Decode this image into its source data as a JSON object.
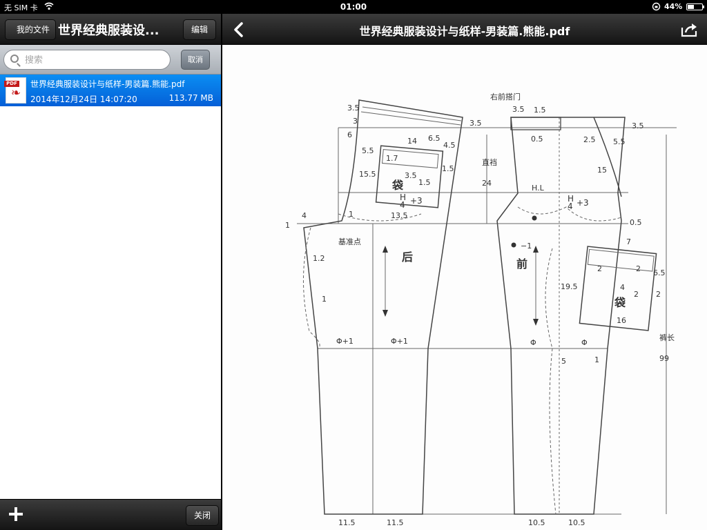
{
  "status_bar": {
    "carrier": "无 SIM 卡",
    "time": "01:00",
    "battery": "44%",
    "battery_level": 0.44
  },
  "left_pane": {
    "back_label": "我的文件",
    "title": "世界经典服装设...",
    "edit_label": "编辑",
    "search_placeholder": "搜索",
    "cancel_label": "取消",
    "file": {
      "icon_text": "PDF",
      "name": "世界经典服装设计与纸样-男装篇.熊能.pdf",
      "date": "2014年12月24日 14:07:20",
      "size": "113.77 MB"
    },
    "close_label": "关闭"
  },
  "viewer": {
    "title": "世界经典服装设计与纸样-男装篇.熊能.pdf"
  },
  "pattern": {
    "fly_label": "右前搭门",
    "fly_width": "1.5",
    "crotch_label": "直裆",
    "crotch_value": "24",
    "hip_line": "H.L",
    "reference_point": "基准点",
    "back_label": "后",
    "front_label": "前",
    "pocket_label": "袋",
    "trouser_length_label": "裤长",
    "trouser_length_value": "99",
    "hem_back": "11.5",
    "hem_front": "10.5",
    "phi_plus": "Φ+1",
    "phi": "Φ",
    "h4_num": "H",
    "h4_den": "4",
    "plus3": "+3",
    "n_35": "3.5",
    "n_3": "3",
    "n_6": "6",
    "n_14": "14",
    "n_65": "6.5",
    "n_45": "4.5",
    "n_55": "5.5",
    "n_17": "1.7",
    "n_15": "1.5",
    "n_155": "15.5",
    "n_135": "13.5",
    "n_4": "4",
    "n_1": "1",
    "n_12": "1.2",
    "n_05": "0.5",
    "n_25": "2.5",
    "n_15b": "15",
    "n_m1": "−1",
    "n_7": "7",
    "n_2": "2",
    "n_195": "19.5",
    "n_16": "16",
    "n_5": "5"
  }
}
